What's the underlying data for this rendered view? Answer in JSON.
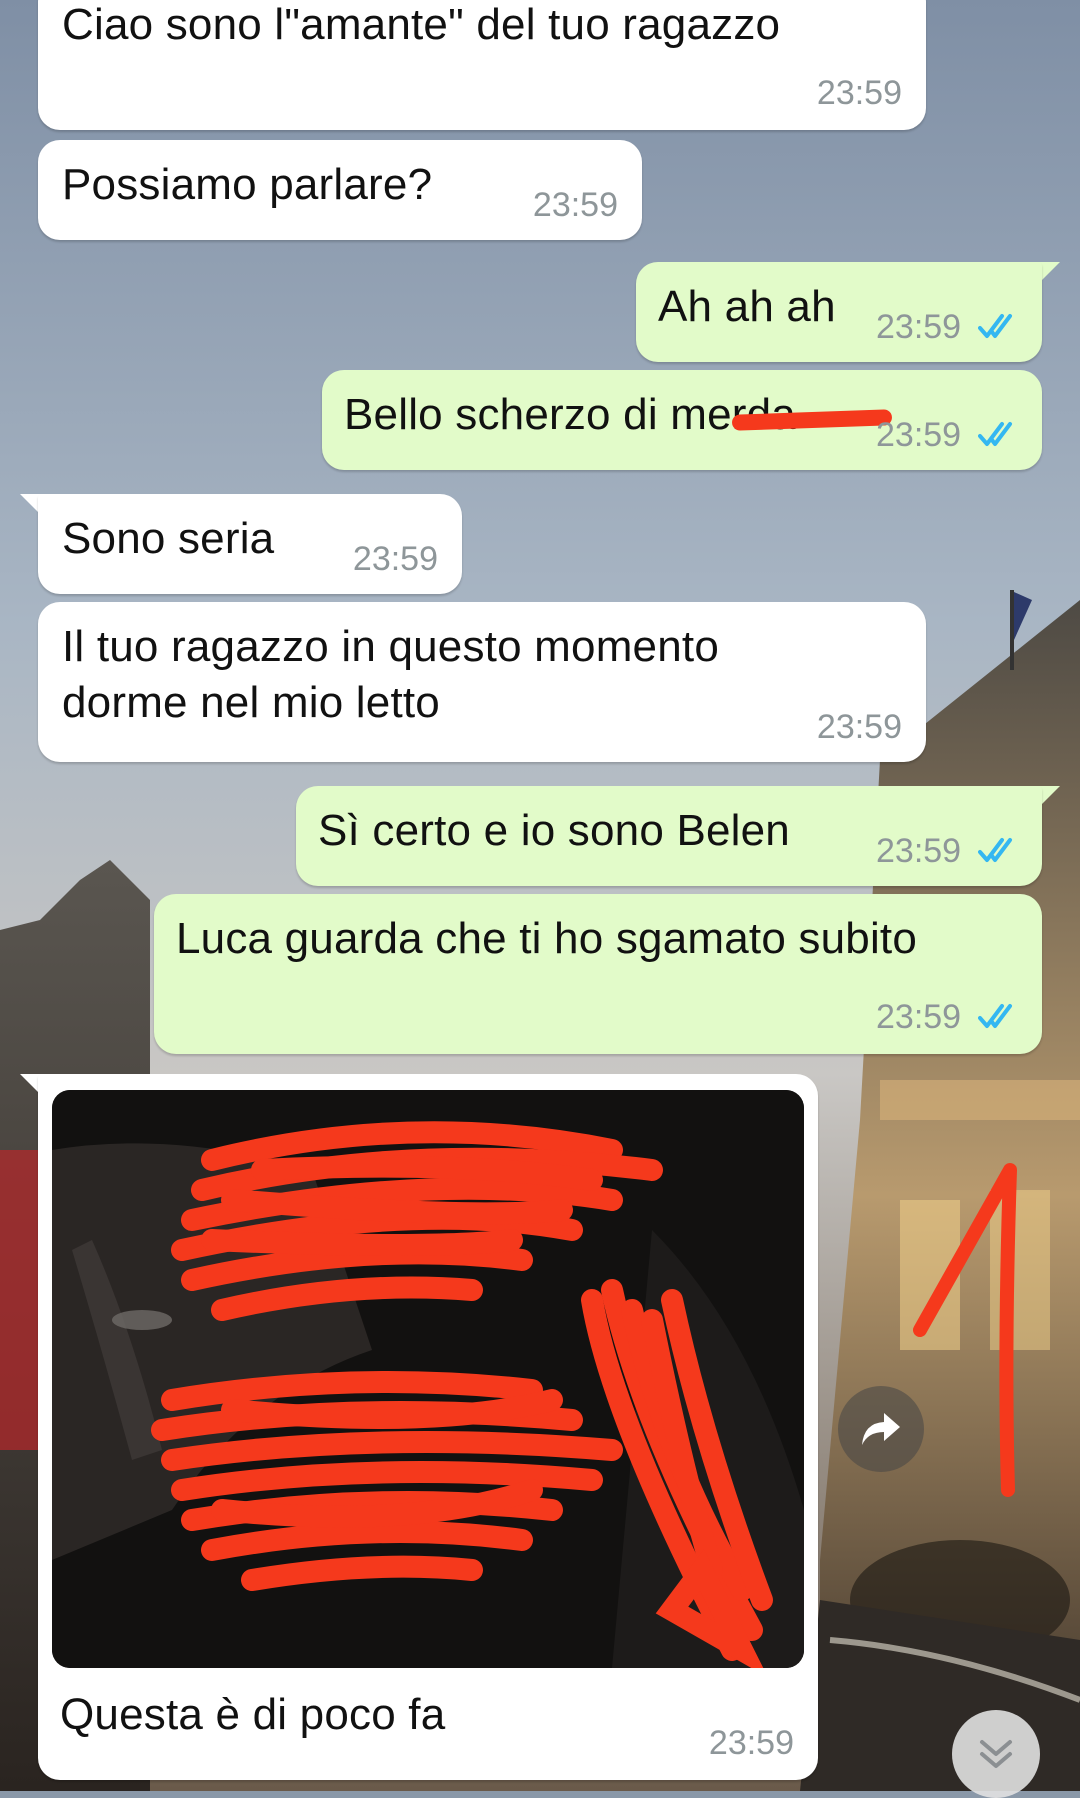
{
  "messages": [
    {
      "id": "m1",
      "direction": "incoming",
      "text": "Ciao sono l\"amante\" del tuo ragazzo",
      "time": "23:59"
    },
    {
      "id": "m2",
      "direction": "incoming",
      "text": "Possiamo parlare?",
      "time": "23:59"
    },
    {
      "id": "m3",
      "direction": "outgoing",
      "text": "Ah ah ah",
      "time": "23:59",
      "status": "read"
    },
    {
      "id": "m4",
      "direction": "outgoing",
      "text": "Bello scherzo di merda",
      "time": "23:59",
      "status": "read"
    },
    {
      "id": "m5",
      "direction": "incoming",
      "text": "Sono seria",
      "time": "23:59"
    },
    {
      "id": "m6",
      "direction": "incoming",
      "text_line1": "Il tuo ragazzo in questo momento",
      "text_line2": "dorme nel mio letto",
      "time": "23:59"
    },
    {
      "id": "m7",
      "direction": "outgoing",
      "text": "Sì certo e io sono Belen",
      "time": "23:59",
      "status": "read"
    },
    {
      "id": "m8",
      "direction": "outgoing",
      "text": "Luca guarda che ti ho sgamato subito",
      "time": "23:59",
      "status": "read"
    },
    {
      "id": "m9",
      "direction": "incoming",
      "type": "image",
      "caption": "Questa è di poco fa",
      "time": "23:59"
    }
  ],
  "icons": {
    "read_ticks": "double-check-icon",
    "share": "forward-arrow-icon",
    "scroll_down": "chevron-double-down-icon"
  },
  "colors": {
    "incoming_bubble": "#ffffff",
    "outgoing_bubble": "#e2fbc9",
    "read_ticks": "#34b7f1",
    "timestamp": "#8e9699",
    "redaction": "#f5391c"
  }
}
